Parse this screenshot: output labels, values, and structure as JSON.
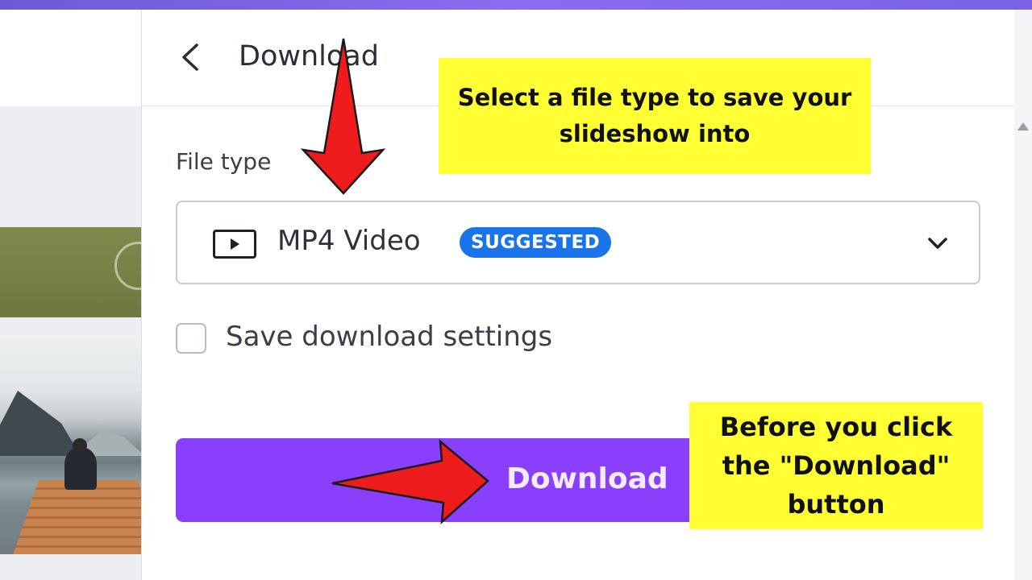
{
  "panel": {
    "title": "Download",
    "file_type_label": "File type",
    "file_type_select": {
      "value": "MP4 Video",
      "badge": "SUGGESTED",
      "icon": "video-play-icon"
    },
    "save_settings_label": "Save download settings",
    "save_settings_checked": false,
    "download_button_label": "Download"
  },
  "annotations": {
    "note_top": "Select a file type to save your slideshow into",
    "note_bottom": "Before you click the \"Download\" button"
  },
  "colors": {
    "accent": "#8a3ffc",
    "badge": "#1a73e8",
    "annotation_bg": "#ffff33",
    "arrow": "#ee1c1c"
  }
}
